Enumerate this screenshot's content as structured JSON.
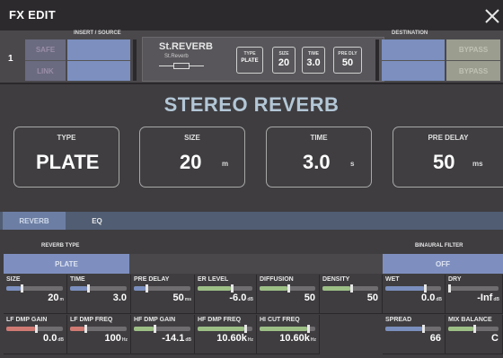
{
  "window": {
    "title": "FX EDIT"
  },
  "routing": {
    "channel_number": "1",
    "insert_source_label": "INSERT / SOURCE",
    "destination_label": "DESTINATION",
    "safe_label": "SAFE",
    "link_label": "LINK",
    "bypass_label_1": "BYPASS",
    "bypass_label_2": "BYPASS"
  },
  "fx_module": {
    "name": "St.REVERB",
    "sub_name": "St.Reverb",
    "params": [
      {
        "label": "TYPE",
        "value": "PLATE"
      },
      {
        "label": "SIZE",
        "value": "20"
      },
      {
        "label": "TIME",
        "value": "3.0"
      },
      {
        "label": "PRE DLY",
        "value": "50"
      }
    ]
  },
  "main": {
    "fx_title": "STEREO REVERB",
    "big_params": [
      {
        "label": "TYPE",
        "value": "PLATE",
        "unit": ""
      },
      {
        "label": "SIZE",
        "value": "20",
        "unit": "m"
      },
      {
        "label": "TIME",
        "value": "3.0",
        "unit": "s"
      },
      {
        "label": "PRE DELAY",
        "value": "50",
        "unit": "ms"
      }
    ]
  },
  "tabs": [
    {
      "label": "REVERB",
      "active": true
    },
    {
      "label": "EQ",
      "active": false
    }
  ],
  "sections": {
    "reverb_type_label": "REVERB TYPE",
    "reverb_type_value": "PLATE",
    "binaural_label": "BINAURAL FILTER",
    "binaural_value": "OFF"
  },
  "params_row1": [
    {
      "label": "SIZE",
      "value": "20",
      "unit": "m",
      "level": 0.25,
      "color": "#7b8fbe"
    },
    {
      "label": "TIME",
      "value": "3.0",
      "unit": "",
      "level": 0.3,
      "color": "#7b8fbe"
    },
    {
      "label": "PRE DELAY",
      "value": "50",
      "unit": "ms",
      "level": 0.2,
      "color": "#7b8fbe"
    },
    {
      "label": "ER LEVEL",
      "value": "-6.0",
      "unit": "dB",
      "level": 0.6,
      "color": "#9dbf86"
    },
    {
      "label": "DIFFUSION",
      "value": "50",
      "unit": "",
      "level": 0.5,
      "color": "#9dbf86"
    },
    {
      "label": "DENSITY",
      "value": "50",
      "unit": "",
      "level": 0.5,
      "color": "#9dbf86"
    },
    {
      "label": "WET",
      "value": "0.0",
      "unit": "dB",
      "level": 0.7,
      "color": "#7b8fbe"
    },
    {
      "label": "DRY",
      "value": "-Inf",
      "unit": "dB",
      "level": 0.0,
      "color": "#9dbf86"
    }
  ],
  "params_row2": [
    {
      "label": "LF DMP GAIN",
      "value": "0.0",
      "unit": "dB",
      "level": 0.5,
      "color": "#d07a74"
    },
    {
      "label": "LF DMP FREQ",
      "value": "100",
      "unit": "Hz",
      "level": 0.25,
      "color": "#d07a74"
    },
    {
      "label": "HF DMP GAIN",
      "value": "-14.1",
      "unit": "dB",
      "level": 0.35,
      "color": "#9dbf86"
    },
    {
      "label": "HF DMP FREQ",
      "value": "10.60k",
      "unit": "Hz",
      "level": 0.85,
      "color": "#9dbf86"
    },
    {
      "label": "HI CUT FREQ",
      "value": "10.60k",
      "unit": "Hz",
      "level": 0.85,
      "color": "#9dbf86"
    },
    {
      "label": "SPREAD",
      "value": "66",
      "unit": "",
      "level": 0.66,
      "color": "#7b8fbe"
    },
    {
      "label": "MIX BALANCE",
      "value": "C",
      "unit": "",
      "level": 0.5,
      "color": "#9dbf86"
    }
  ]
}
